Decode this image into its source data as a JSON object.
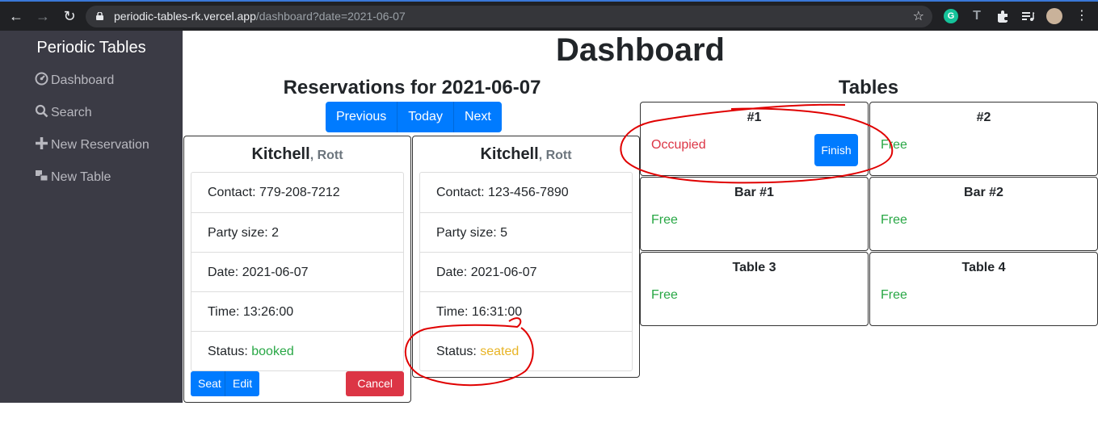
{
  "browser": {
    "url_host": "periodic-tables-rk.vercel.app",
    "url_path": "/dashboard?date=2021-06-07"
  },
  "sidebar": {
    "brand": "Periodic Tables",
    "items": [
      {
        "label": "Dashboard",
        "icon": "dashboard-icon"
      },
      {
        "label": "Search",
        "icon": "search-icon"
      },
      {
        "label": "New Reservation",
        "icon": "plus-icon"
      },
      {
        "label": "New Table",
        "icon": "table-icon"
      }
    ]
  },
  "page": {
    "title": "Dashboard",
    "reservations_heading": "Reservations for 2021-06-07",
    "tables_heading": "Tables",
    "nav_buttons": {
      "previous": "Previous",
      "today": "Today",
      "next": "Next"
    }
  },
  "reservations": [
    {
      "last_name": "Kitchell",
      "first_name": ", Rott",
      "contact_label": "Contact: ",
      "contact": "779-208-7212",
      "party_label": "Party size: ",
      "party": "2",
      "date_label": "Date: ",
      "date": "2021-06-07",
      "time_label": "Time: ",
      "time": "13:26:00",
      "status_label": "Status: ",
      "status": "booked",
      "seat_label": "Seat",
      "edit_label": "Edit",
      "cancel_label": "Cancel"
    },
    {
      "last_name": "Kitchell",
      "first_name": ", Rott",
      "contact_label": "Contact: ",
      "contact": "123-456-7890",
      "party_label": "Party size: ",
      "party": "5",
      "date_label": "Date: ",
      "date": "2021-06-07",
      "time_label": "Time: ",
      "time": "16:31:00",
      "status_label": "Status: ",
      "status": "seated"
    }
  ],
  "tables": [
    {
      "name": "#1",
      "status": "Occupied",
      "finish_label": "Finish"
    },
    {
      "name": "#2",
      "status": "Free"
    },
    {
      "name": "Bar #1",
      "status": "Free"
    },
    {
      "name": "Bar #2",
      "status": "Free"
    },
    {
      "name": "Table 3",
      "status": "Free"
    },
    {
      "name": "Table 4",
      "status": "Free"
    }
  ],
  "colors": {
    "primary": "#007bff",
    "danger": "#dc3545",
    "success": "#28a745",
    "warning": "#e8b425",
    "sidebar": "#3b3b45",
    "annotation": "#e00000"
  }
}
